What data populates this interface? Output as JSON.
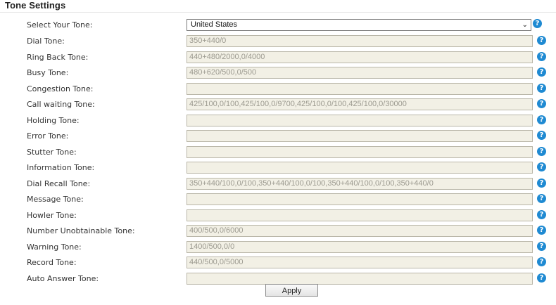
{
  "section": {
    "title": "Tone Settings"
  },
  "select_tone": {
    "label": "Select Your Tone:",
    "value": "United States"
  },
  "fields": [
    {
      "label": "Dial Tone:",
      "value": "350+440/0"
    },
    {
      "label": "Ring Back Tone:",
      "value": "440+480/2000,0/4000"
    },
    {
      "label": "Busy Tone:",
      "value": "480+620/500,0/500"
    },
    {
      "label": "Congestion Tone:",
      "value": ""
    },
    {
      "label": "Call waiting Tone:",
      "value": "425/100,0/100,425/100,0/9700,425/100,0/100,425/100,0/30000"
    },
    {
      "label": "Holding Tone:",
      "value": ""
    },
    {
      "label": "Error Tone:",
      "value": ""
    },
    {
      "label": "Stutter Tone:",
      "value": ""
    },
    {
      "label": "Information Tone:",
      "value": ""
    },
    {
      "label": "Dial Recall Tone:",
      "value": "350+440/100,0/100,350+440/100,0/100,350+440/100,0/100,350+440/0"
    },
    {
      "label": "Message Tone:",
      "value": ""
    },
    {
      "label": "Howler Tone:",
      "value": ""
    },
    {
      "label": "Number Unobtainable Tone:",
      "value": "400/500,0/6000"
    },
    {
      "label": "Warning Tone:",
      "value": "1400/500,0/0"
    },
    {
      "label": "Record Tone:",
      "value": "440/500,0/5000"
    },
    {
      "label": "Auto Answer Tone:",
      "value": ""
    }
  ],
  "help_icon": "question-circle-icon",
  "help_glyph": "?",
  "chevron_glyph": "⌄",
  "apply_label": "Apply",
  "colors": {
    "help_icon": "#1f8ad2",
    "field_bg": "#f2f0e5"
  }
}
